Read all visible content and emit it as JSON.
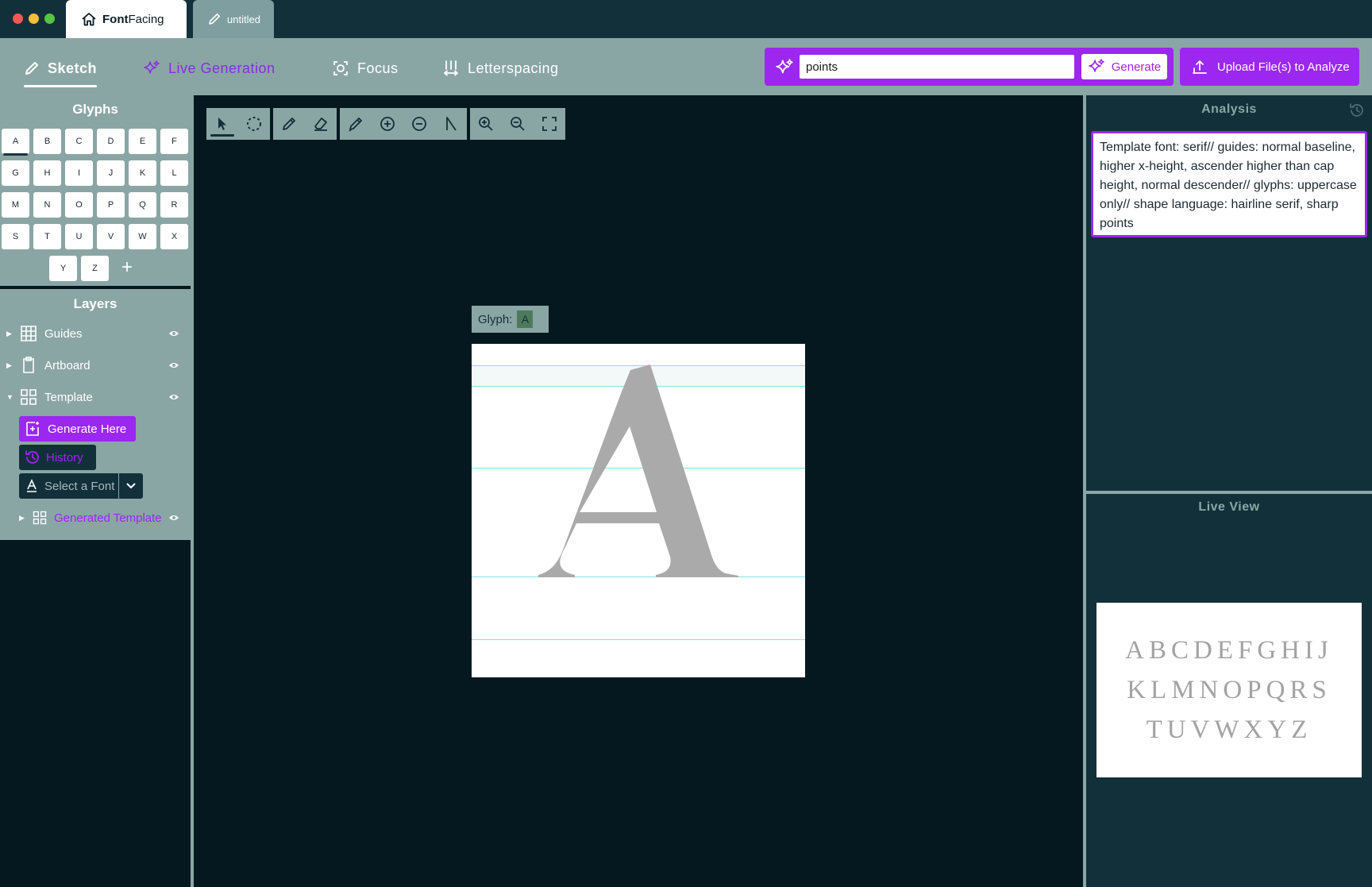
{
  "titlebar": {
    "home_tab": {
      "brand_bold": "Font",
      "brand_regular": "Facing"
    },
    "file_tab": {
      "label": "untitled"
    }
  },
  "toolbar": {
    "modes": [
      {
        "label": "Sketch",
        "icon": "pencil-icon",
        "state": "active"
      },
      {
        "label": "Live Generation",
        "icon": "sparkles-icon",
        "state": "highlighted"
      },
      {
        "label": "Focus",
        "icon": "focus-icon",
        "state": "normal"
      },
      {
        "label": "Letterspacing",
        "icon": "letterspacing-icon",
        "state": "normal"
      }
    ],
    "generate": {
      "input_value": "points",
      "button_label": "Generate",
      "icon": "sparkles-icon"
    },
    "upload": {
      "label": "Upload File(s) to Analyze",
      "icon": "upload-icon"
    }
  },
  "glyphs": {
    "title": "Glyphs",
    "keys": [
      "A",
      "B",
      "C",
      "D",
      "E",
      "F",
      "G",
      "H",
      "I",
      "J",
      "K",
      "L",
      "M",
      "N",
      "O",
      "P",
      "Q",
      "R",
      "S",
      "T",
      "U",
      "V",
      "W",
      "X",
      "Y",
      "Z"
    ],
    "selected": "A",
    "add_label": "+"
  },
  "layers": {
    "title": "Layers",
    "items": [
      {
        "label": "Guides",
        "icon": "grid-icon",
        "expanded": false,
        "visible": true
      },
      {
        "label": "Artboard",
        "icon": "clipboard-icon",
        "expanded": false,
        "visible": true
      },
      {
        "label": "Template",
        "icon": "layout-icon",
        "expanded": true,
        "visible": true
      }
    ],
    "generate_here": "Generate Here",
    "history": "History",
    "font_select_placeholder": "Select a Font",
    "generated_template": "Generated Template"
  },
  "canvas": {
    "tools": [
      "select-icon",
      "lasso-icon",
      "pen-icon",
      "eraser-icon",
      "brush-icon",
      "add-point-icon",
      "remove-point-icon",
      "corner-icon",
      "zoom-in-icon",
      "zoom-out-icon",
      "fit-screen-icon"
    ],
    "active_tool": "select-icon",
    "glyph_label": "Glyph:",
    "glyph_value": "A"
  },
  "analysis": {
    "title": "Analysis",
    "text": "Template font: serif// guides: normal baseline, higher x-height, ascender higher than cap height, normal descender// glyphs: uppercase only// shape language: hairline serif, sharp points"
  },
  "live_view": {
    "title": "Live View",
    "lines": [
      "ABCDEFGHIJ",
      "KLMNOPQRS",
      "TUVWXYZ"
    ]
  },
  "colors": {
    "accent": "#9b27f0",
    "panel": "#8aa6a4",
    "dark": "#12303a",
    "canvas_bg": "#051820",
    "guide": "#7fe7e9",
    "glyph_fill": "#aaaaaa"
  }
}
